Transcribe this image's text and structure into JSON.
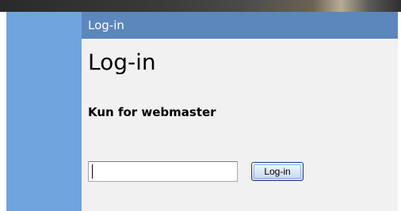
{
  "panel": {
    "header_title": "Log-in",
    "page_title": "Log-in",
    "subtitle": "Kun for webmaster"
  },
  "login": {
    "password_value": "",
    "button_label": "Log-in"
  },
  "colors": {
    "sidebar": "#6fa5df",
    "panel_header": "#5b87bd",
    "panel_background": "#f1f1f1",
    "banner": "#3a3a3a",
    "button_border": "#1f3f72"
  }
}
